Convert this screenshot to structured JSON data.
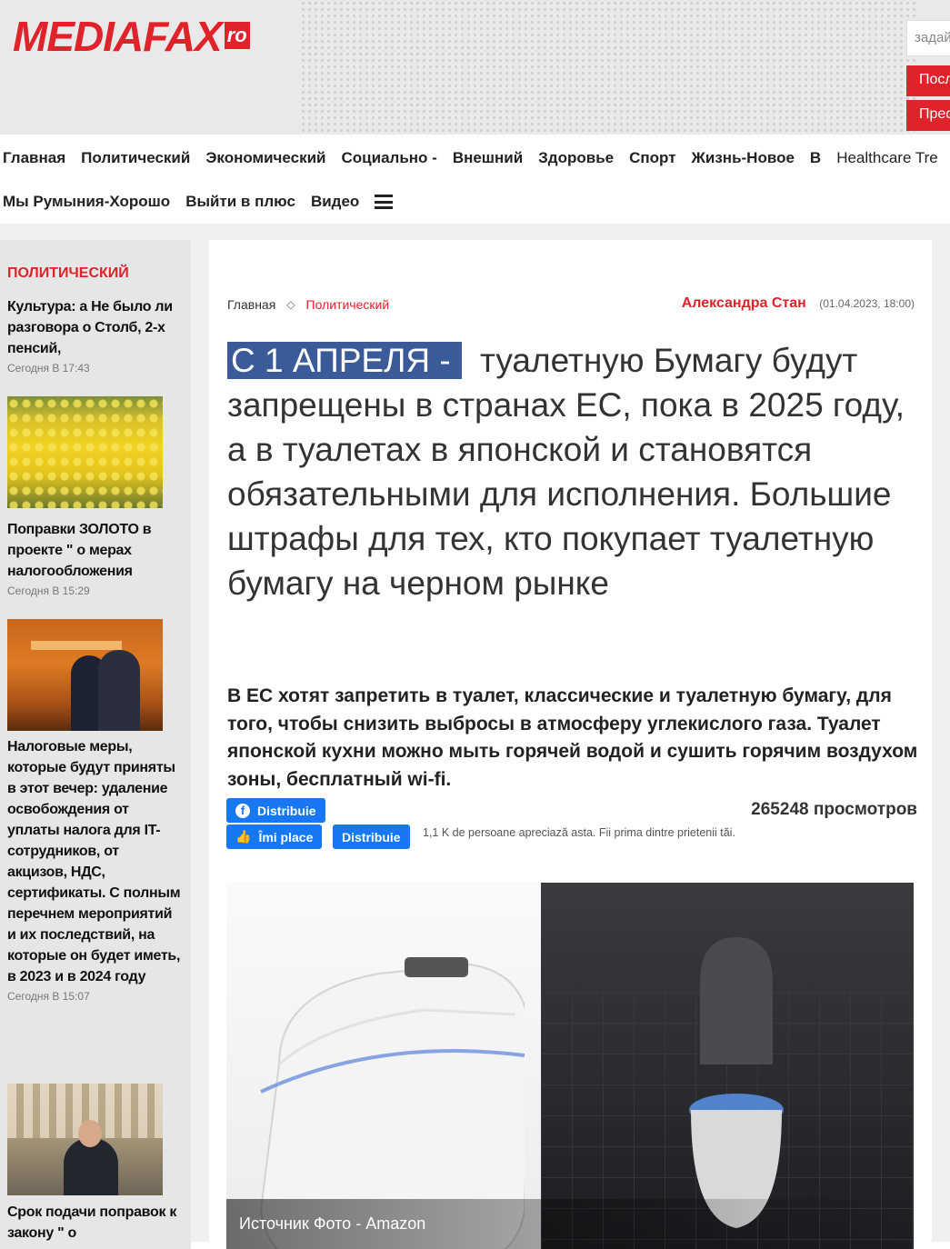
{
  "header": {
    "logo_text": "MEDIAFAX",
    "logo_suffix": "ro",
    "search_placeholder": "задай",
    "button1": "Посл",
    "button2": "Прес"
  },
  "nav": {
    "row1": [
      "Главная",
      "Политический",
      "Экономический",
      "Социально -",
      "Внешний",
      "Здоровье",
      "Спорт",
      "Жизнь-Новое",
      "В",
      "Healthcare Tre"
    ],
    "row2": [
      "Мы Румыния-Хорошо",
      "Выйти в плюс",
      "Видео"
    ]
  },
  "sidebar": {
    "category": "ПОЛИТИЧЕСКИЙ",
    "items": [
      {
        "title": "Культура: а Не было ли разговора о Столб, 2-х пенсий,",
        "time": "Сегодня В 17:43"
      },
      {
        "title": "Поправки ЗОЛОТО в проекте \" о мерах налогообложения",
        "time": "Сегодня В 15:29"
      },
      {
        "title": "Налоговые меры, которые будут приняты в этот вечер: удаление освобождения от уплаты налога для IT-сотрудников, от акцизов, НДС, сертификаты. С полным перечнем мероприятий и их последствий, на которые он будет иметь, в 2023 и в 2024 году",
        "time": "Сегодня В 15:07"
      },
      {
        "title": "Срок подачи поправок к закону \" о",
        "time": ""
      }
    ]
  },
  "article": {
    "breadcrumb_home": "Главная",
    "breadcrumb_category": "Политический",
    "author": "Александра Стан",
    "date": "(01.04.2023, 18:00)",
    "headline_highlight": "С 1 АПРЕЛЯ -",
    "headline_rest": "туалетную Бумагу будут запрещены в странах ЕС, пока в 2025 году, а в туалетах в японской и становятся обязательными для исполнения. Большие штрафы для тех, кто покупает туалетную бумагу на черном рынке",
    "lead": "В ЕС хотят запретить в туалет, классические и туалетную бумагу, для того, чтобы снизить выбросы в атмосферу углекислого газа. Туалет японской кухни можно мыть горячей водой и сушить горячим воздухом зоны, бесплатный wi-fi.",
    "share_label": "Distribuie",
    "like_label": "Îmi place",
    "share2_label": "Distribuie",
    "like_note": "1,1 K de persoane apreciază asta. Fii prima dintre prietenii tăi.",
    "views": "265248 просмотров",
    "photo_caption": "Источник Фото - Amazon"
  },
  "colors": {
    "brand_red": "#e0232b",
    "highlight_blue": "#3a5a99",
    "facebook_blue": "#1877f2"
  }
}
